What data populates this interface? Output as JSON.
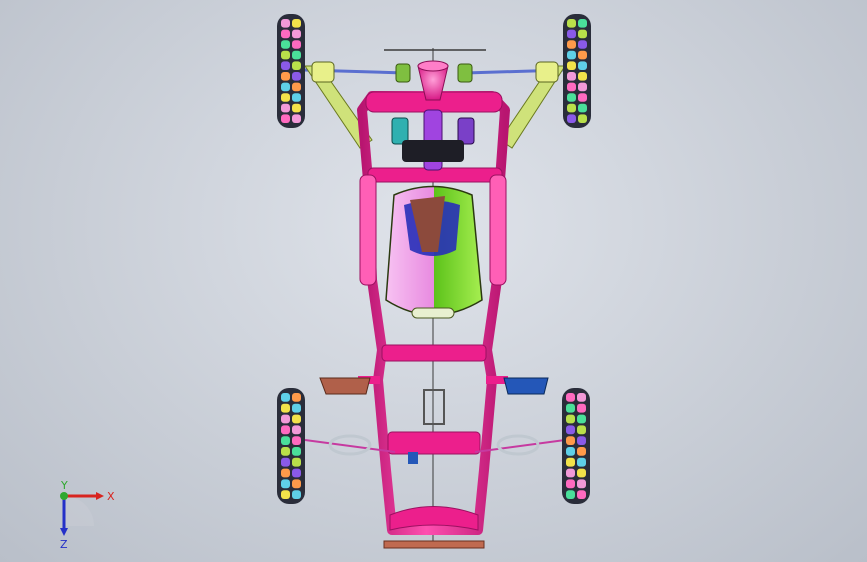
{
  "viewport": {
    "background_colors": [
      "#dfe3ea",
      "#b9bfc9"
    ]
  },
  "model": {
    "colors": {
      "frame": "#ec1f8c",
      "frame_dark": "#b81570",
      "seat_green": "#7fdc2a",
      "seat_pink": "#f2a6ee",
      "seat_back": "#8c4a3c",
      "seat_blue": "#2730b8",
      "tire_dark": "#2a2d3a",
      "control_arm": "#cfe27a",
      "tie_rod": "#5a6fd0",
      "pedal_brown": "#b0604a",
      "pedal_blue": "#2457b8",
      "steering_post": "#f06ab5",
      "engine_purple": "#a044e0",
      "engine_cyan": "#2fb0b0",
      "centerline": "#3a3a3a"
    },
    "tread_colors": [
      "#f29ad8",
      "#b9e04a",
      "#5fd0e8",
      "#ff6ac0",
      "#8a5ae8",
      "#f2e24a",
      "#4ae09a",
      "#ff9a4a"
    ]
  },
  "triad": {
    "x_label": "X",
    "y_label": "Y",
    "z_label": "Z",
    "x_color": "#d8241f",
    "y_color": "#2ea82e",
    "z_color": "#2430c8"
  }
}
